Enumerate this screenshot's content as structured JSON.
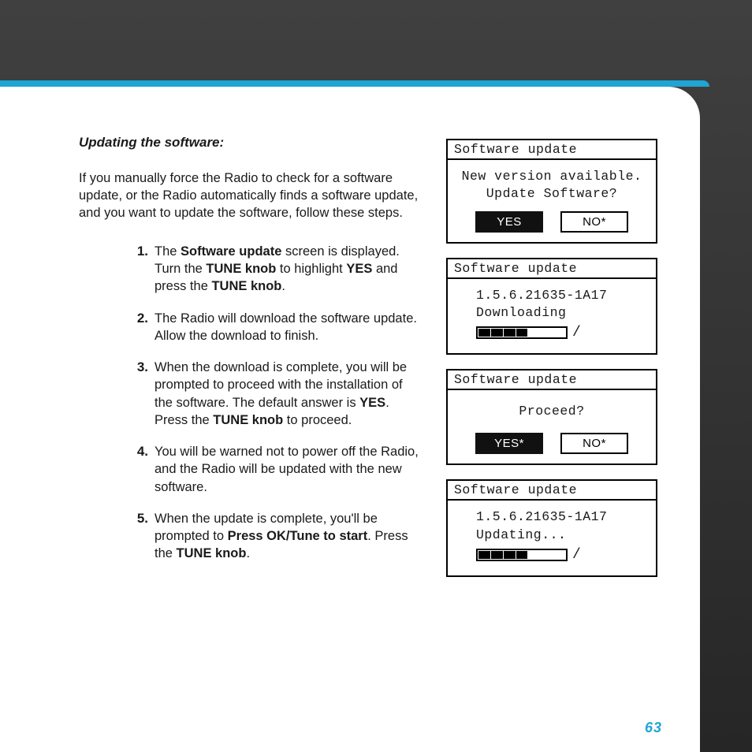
{
  "page_number": "63",
  "section_title": "Updating the software:",
  "intro": "If you manually force the Radio to check for a software update, or the Radio automatically finds a software update, and you want to update the software, follow these steps.",
  "steps": {
    "s1": {
      "num": "1.",
      "pre": "The ",
      "b1": "Software update",
      "mid1": " screen is displayed. Turn the ",
      "b2": "TUNE knob",
      "mid2": " to highlight ",
      "b3": "YES",
      "mid3": " and press the ",
      "b4": "TUNE knob",
      "post": "."
    },
    "s2": {
      "num": "2.",
      "text": "The Radio will download the software update. Allow the download to finish."
    },
    "s3": {
      "num": "3.",
      "pre": "When the download is complete, you will be prompted to proceed with the installation of the software. The default answer is ",
      "b1": "YES",
      "mid1": ". Press the ",
      "b2": "TUNE knob",
      "post": " to proceed."
    },
    "s4": {
      "num": "4.",
      "text": "You will be warned not to power off the Radio, and the Radio will be updated with the new software."
    },
    "s5": {
      "num": "5.",
      "pre": "When the update is complete, you'll be prompted to ",
      "b1": "Press OK/Tune to start",
      "mid1": ". Press the ",
      "b2": "TUNE knob",
      "post": "."
    }
  },
  "screens": {
    "s1": {
      "title": "Software update",
      "line1": "New version available.",
      "line2": "Update Software?",
      "yes": "YES",
      "no": "NO*"
    },
    "s2": {
      "title": "Software update",
      "version": "1.5.6.21635-1A17",
      "status": "Downloading",
      "spinner": "/"
    },
    "s3": {
      "title": "Software update",
      "line1": "Proceed?",
      "yes": "YES*",
      "no": "NO*"
    },
    "s4": {
      "title": "Software update",
      "version": "1.5.6.21635-1A17",
      "status": "Updating...",
      "spinner": "/"
    }
  }
}
